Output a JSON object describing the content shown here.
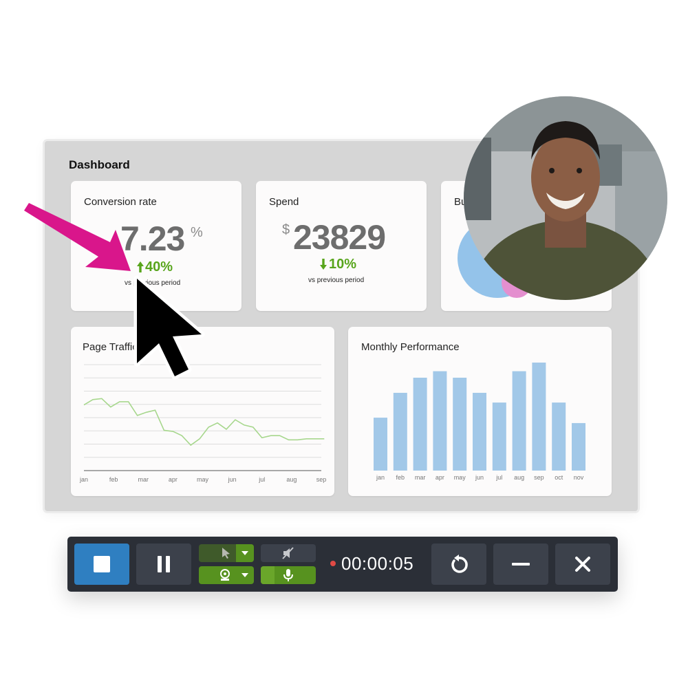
{
  "dashboard": {
    "title": "Dashboard",
    "cards": [
      {
        "title": "Conversion rate",
        "value": "7.23",
        "unit": "%",
        "change": "40%",
        "direction": "up",
        "caption": "vs previous period"
      },
      {
        "title": "Spend",
        "currency": "$",
        "value": "23829",
        "change": "10%",
        "direction": "down",
        "caption": "vs previous period"
      },
      {
        "title": "Bu"
      }
    ]
  },
  "page_traffic": {
    "title": "Page Traffic",
    "chart_data": {
      "type": "line",
      "title": "Page Traffic",
      "categories": [
        "jan",
        "feb",
        "mar",
        "apr",
        "may",
        "jun",
        "jul",
        "aug",
        "sep"
      ],
      "x": [
        0,
        0.3,
        0.6,
        0.9,
        1.2,
        1.5,
        1.8,
        2.1,
        2.4,
        2.7,
        3.0,
        3.3,
        3.6,
        3.9,
        4.2,
        4.5,
        4.8,
        5.1,
        5.4,
        5.7,
        6.0,
        6.3,
        6.6,
        6.9,
        7.2,
        7.5,
        7.8,
        8.1
      ],
      "values": [
        62,
        67,
        68,
        60,
        65,
        65,
        52,
        55,
        57,
        38,
        37,
        33,
        24,
        30,
        41,
        45,
        39,
        48,
        43,
        41,
        31,
        33,
        33,
        29,
        29,
        30,
        30,
        30
      ],
      "ylim": [
        0,
        100
      ],
      "grid": true,
      "color": "#a7d78d"
    }
  },
  "monthly_performance": {
    "title": "Monthly Performance",
    "chart_data": {
      "type": "bar",
      "title": "Monthly Performance",
      "categories": [
        "jan",
        "feb",
        "mar",
        "apr",
        "may",
        "jun",
        "jul",
        "aug",
        "sep",
        "oct",
        "nov"
      ],
      "values": [
        49,
        72,
        86,
        92,
        86,
        72,
        63,
        92,
        100,
        63,
        44
      ],
      "ylim": [
        0,
        100
      ],
      "color": "#a2c8e8"
    }
  },
  "toolbar": {
    "timer": "00:00:05",
    "accent_blue": "#2f7fc1",
    "accent_green": "#57921f",
    "recording_dot": "#e04a45"
  },
  "annotations": {
    "arrow_color": "#d9168b"
  }
}
